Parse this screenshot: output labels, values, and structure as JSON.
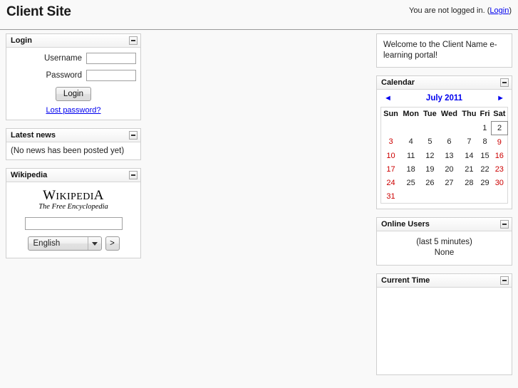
{
  "header": {
    "site_title": "Client Site",
    "status_text": "You are not logged in. (",
    "login_link": "Login",
    "status_close": ")"
  },
  "login_block": {
    "title": "Login",
    "collapse_icon": "minus-icon",
    "username_label": "Username",
    "username_value": "",
    "username_placeholder": "",
    "password_label": "Password",
    "password_value": "",
    "password_placeholder": "",
    "submit_label": "Login",
    "lost_password_label": "Lost password?"
  },
  "news_block": {
    "title": "Latest news",
    "collapse_icon": "minus-icon",
    "empty_text": "(No news has been posted yet)"
  },
  "wikipedia_block": {
    "title": "Wikipedia",
    "collapse_icon": "minus-icon",
    "logo_w": "W",
    "logo_ikipedi": "IKIPEDI",
    "logo_a": "A",
    "tagline": "The Free Encyclopedia",
    "search_value": "",
    "search_placeholder": "",
    "language_selected": "English",
    "language_options": [
      "English"
    ],
    "go_label": ">"
  },
  "welcome_box": {
    "text": "Welcome to the Client Name e-learning portal!"
  },
  "calendar_block": {
    "title": "Calendar",
    "collapse_icon": "minus-icon",
    "prev_arrow": "◄",
    "next_arrow": "►",
    "month_label": "July 2011",
    "weekday_headers": [
      "Sun",
      "Mon",
      "Tue",
      "Wed",
      "Thu",
      "Fri",
      "Sat"
    ],
    "weeks": [
      [
        {
          "day": "",
          "weekend": false,
          "today": false
        },
        {
          "day": "",
          "weekend": false,
          "today": false
        },
        {
          "day": "",
          "weekend": false,
          "today": false
        },
        {
          "day": "",
          "weekend": false,
          "today": false
        },
        {
          "day": "",
          "weekend": false,
          "today": false
        },
        {
          "day": "1",
          "weekend": false,
          "today": false
        },
        {
          "day": "2",
          "weekend": false,
          "today": true
        }
      ],
      [
        {
          "day": "3",
          "weekend": true,
          "today": false
        },
        {
          "day": "4",
          "weekend": false,
          "today": false
        },
        {
          "day": "5",
          "weekend": false,
          "today": false
        },
        {
          "day": "6",
          "weekend": false,
          "today": false
        },
        {
          "day": "7",
          "weekend": false,
          "today": false
        },
        {
          "day": "8",
          "weekend": false,
          "today": false
        },
        {
          "day": "9",
          "weekend": true,
          "today": false
        }
      ],
      [
        {
          "day": "10",
          "weekend": true,
          "today": false
        },
        {
          "day": "11",
          "weekend": false,
          "today": false
        },
        {
          "day": "12",
          "weekend": false,
          "today": false
        },
        {
          "day": "13",
          "weekend": false,
          "today": false
        },
        {
          "day": "14",
          "weekend": false,
          "today": false
        },
        {
          "day": "15",
          "weekend": false,
          "today": false
        },
        {
          "day": "16",
          "weekend": true,
          "today": false
        }
      ],
      [
        {
          "day": "17",
          "weekend": true,
          "today": false
        },
        {
          "day": "18",
          "weekend": false,
          "today": false
        },
        {
          "day": "19",
          "weekend": false,
          "today": false
        },
        {
          "day": "20",
          "weekend": false,
          "today": false
        },
        {
          "day": "21",
          "weekend": false,
          "today": false
        },
        {
          "day": "22",
          "weekend": false,
          "today": false
        },
        {
          "day": "23",
          "weekend": true,
          "today": false
        }
      ],
      [
        {
          "day": "24",
          "weekend": true,
          "today": false
        },
        {
          "day": "25",
          "weekend": false,
          "today": false
        },
        {
          "day": "26",
          "weekend": false,
          "today": false
        },
        {
          "day": "27",
          "weekend": false,
          "today": false
        },
        {
          "day": "28",
          "weekend": false,
          "today": false
        },
        {
          "day": "29",
          "weekend": false,
          "today": false
        },
        {
          "day": "30",
          "weekend": true,
          "today": false
        }
      ],
      [
        {
          "day": "31",
          "weekend": true,
          "today": false
        },
        {
          "day": "",
          "weekend": false,
          "today": false
        },
        {
          "day": "",
          "weekend": false,
          "today": false
        },
        {
          "day": "",
          "weekend": false,
          "today": false
        },
        {
          "day": "",
          "weekend": false,
          "today": false
        },
        {
          "day": "",
          "weekend": false,
          "today": false
        },
        {
          "day": "",
          "weekend": false,
          "today": false
        }
      ]
    ]
  },
  "online_users_block": {
    "title": "Online Users",
    "collapse_icon": "minus-icon",
    "subtitle": "(last 5 minutes)",
    "value": "None"
  },
  "current_time_block": {
    "title": "Current Time",
    "collapse_icon": "minus-icon",
    "body_text": ""
  },
  "colors": {
    "link": "#0000ee",
    "weekend": "#cc0000",
    "page_background": "#f9f9f9",
    "block_border": "#cfcfcf",
    "header_rule": "#9a9a9a"
  }
}
